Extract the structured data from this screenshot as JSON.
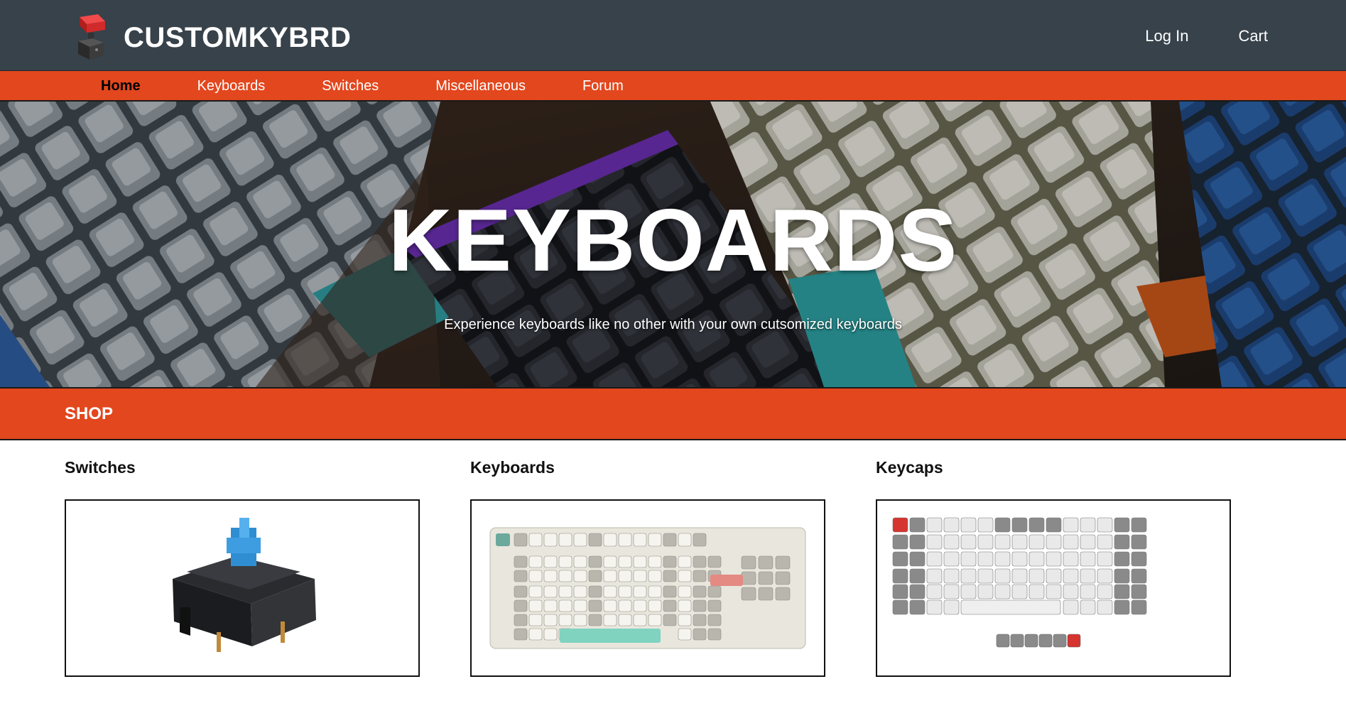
{
  "brand": {
    "name": "CUSTOMKYBRD",
    "logo_icon": "keyswitch-logo-icon"
  },
  "top_links": [
    {
      "label": "Log In"
    },
    {
      "label": "Cart"
    }
  ],
  "nav": {
    "items": [
      {
        "label": "Home",
        "active": true
      },
      {
        "label": "Keyboards",
        "active": false
      },
      {
        "label": "Switches",
        "active": false
      },
      {
        "label": "Miscellaneous",
        "active": false
      },
      {
        "label": "Forum",
        "active": false
      }
    ]
  },
  "hero": {
    "title": "KEYBOARDS",
    "subtitle": "Experience keyboards like no other with your own cutsomized keyboards"
  },
  "shop": {
    "title": "SHOP",
    "cards": [
      {
        "title": "Switches",
        "image": "mechanical-switch-image"
      },
      {
        "title": "Keyboards",
        "image": "tkl-keyboard-image"
      },
      {
        "title": "Keycaps",
        "image": "keycap-set-image"
      }
    ]
  },
  "colors": {
    "header_bg": "#37424b",
    "accent": "#e2471e",
    "text_light": "#ffffff",
    "text_dark": "#111111"
  }
}
